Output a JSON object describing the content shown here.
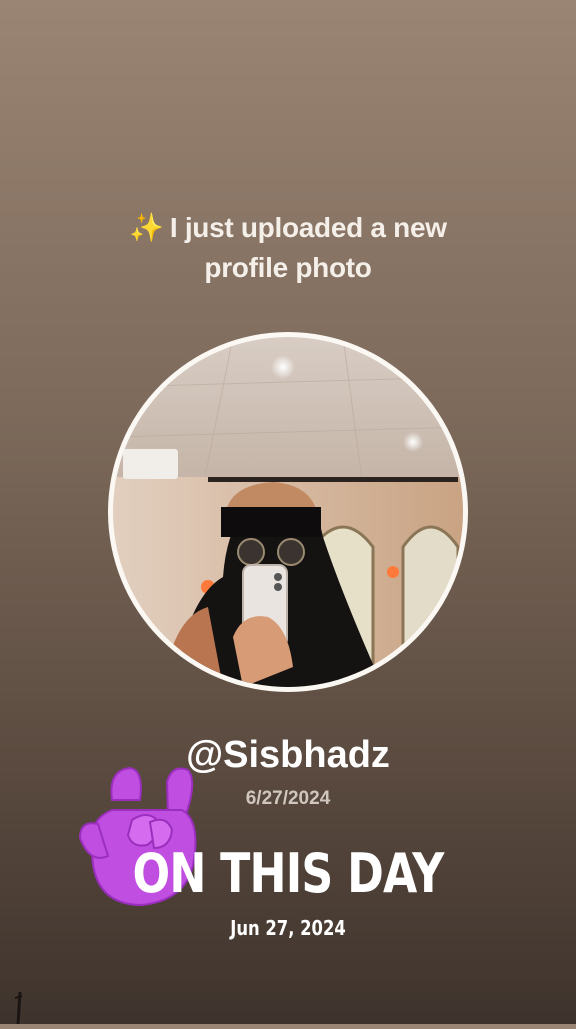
{
  "story": {
    "headline_line1": "I just uploaded a new",
    "headline_line2": "profile photo",
    "sparkle_icon": "sparkles-icon",
    "handle": "@Sisbhadz",
    "upload_date": "6/27/2024",
    "memory_title": "ON THIS DAY",
    "memory_date": "Jun 27, 2024",
    "sticker_icon": "rock-on-hand-icon"
  },
  "colors": {
    "sticker": "#c04ee0",
    "ring": "#fbf8f4",
    "sparkle": "#f5c542"
  }
}
